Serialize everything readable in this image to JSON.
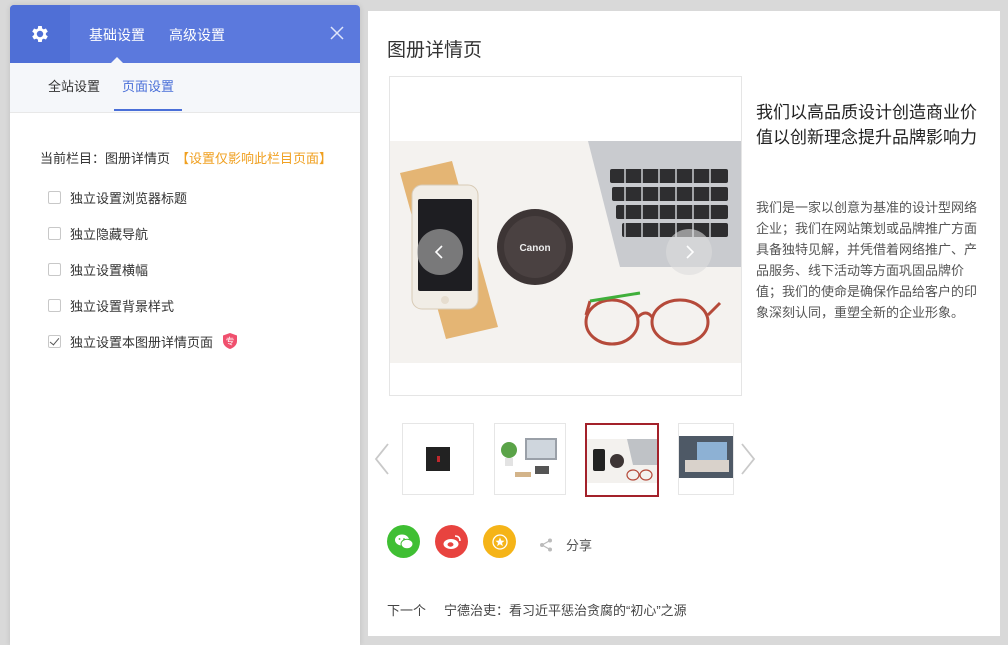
{
  "settings_panel": {
    "tabs": [
      {
        "label": "基础设置",
        "active": true
      },
      {
        "label": "高级设置",
        "active": false
      }
    ],
    "sub_tabs": [
      {
        "label": "全站设置",
        "active": false
      },
      {
        "label": "页面设置",
        "active": true
      }
    ],
    "current_column_label": "当前栏目：图册详情页",
    "current_column_note": "【设置仅影响此栏目页面】",
    "options": [
      {
        "label": "独立设置浏览器标题",
        "checked": false
      },
      {
        "label": "独立隐藏导航",
        "checked": false
      },
      {
        "label": "独立设置横幅",
        "checked": false
      },
      {
        "label": "独立设置背景样式",
        "checked": false
      },
      {
        "label": "独立设置本图册详情页面",
        "checked": true
      }
    ],
    "pro_badge": "专",
    "colors": {
      "header": "#5b79dd",
      "accent": "#4a6fd8",
      "note": "#f0a020",
      "badge": "#f0506e"
    }
  },
  "preview": {
    "page_title": "图册详情页",
    "headline": "我们以高品质设计创造商业价值以创新理念提升品牌影响力",
    "description": "我们是一家以创意为基准的设计型网络企业；我们在网站策划或品牌推广方面具备独特见解，并凭借着网络推广、产品服务、线下活动等方面巩固品牌价值；我们的使命是确保作品给客户的印象深刻认同，重塑全新的企业形象。",
    "lens_cap_text": "Canon",
    "share_label": "分享",
    "next_label": "下一个",
    "next_title": "宁德治吏：看习近平惩治贪腐的“初心”之源",
    "share_colors": {
      "wechat": "#3fbf33",
      "weibo": "#e8433f",
      "favorite": "#f5b418"
    },
    "active_thumb_color": "#a3212a"
  }
}
